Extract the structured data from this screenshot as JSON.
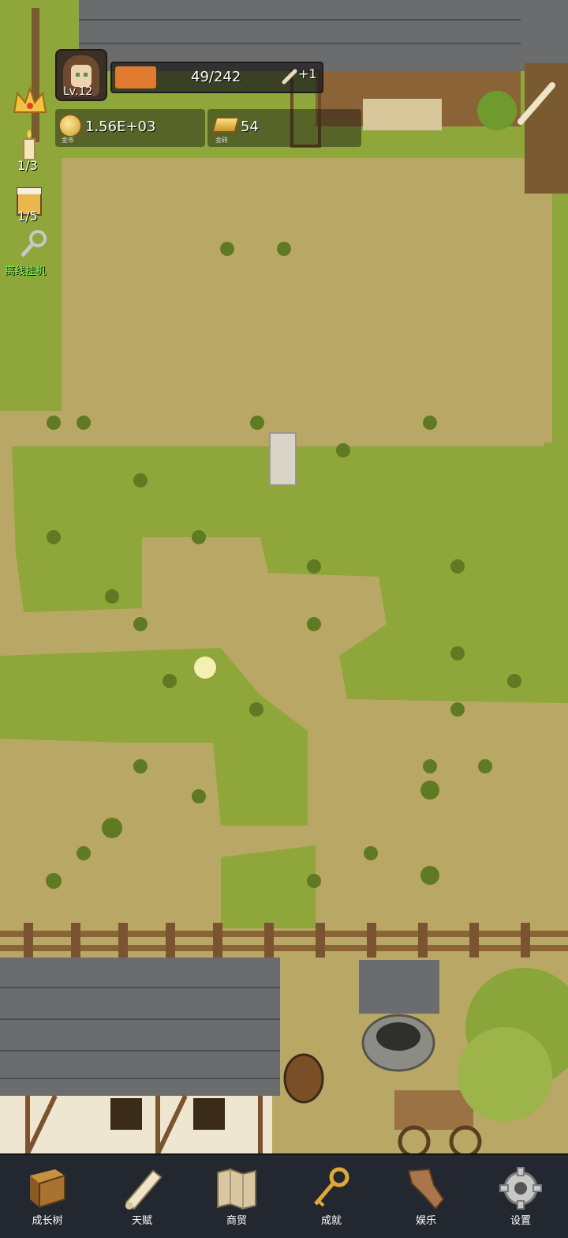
{
  "player": {
    "level": "Lv.12"
  },
  "xp": {
    "text": "49/242",
    "fraction": 0.2025,
    "bonus": "+1"
  },
  "resources": {
    "coins": {
      "value": "1.56E+03",
      "label": "金币"
    },
    "ingots": {
      "value": "54",
      "label": "金砖"
    }
  },
  "side": {
    "candle": {
      "count": "1/3"
    },
    "drink": {
      "count": "1/5"
    },
    "idle": {
      "label": "离线挂机"
    }
  },
  "nav": [
    {
      "label": "成长树",
      "icon": "book-icon"
    },
    {
      "label": "天赋",
      "icon": "scroll-icon"
    },
    {
      "label": "商贸",
      "icon": "map-icon"
    },
    {
      "label": "成就",
      "icon": "key-icon"
    },
    {
      "label": "娱乐",
      "icon": "parchment-icon"
    },
    {
      "label": "设置",
      "icon": "gear-icon"
    }
  ],
  "colors": {
    "dirt": "#b9a865",
    "grass": "#8ea63a",
    "roof": "#6b6c6e",
    "wood": "#8a6436",
    "nav_bg": "#232830",
    "xp_fill": "#e07a2e"
  }
}
